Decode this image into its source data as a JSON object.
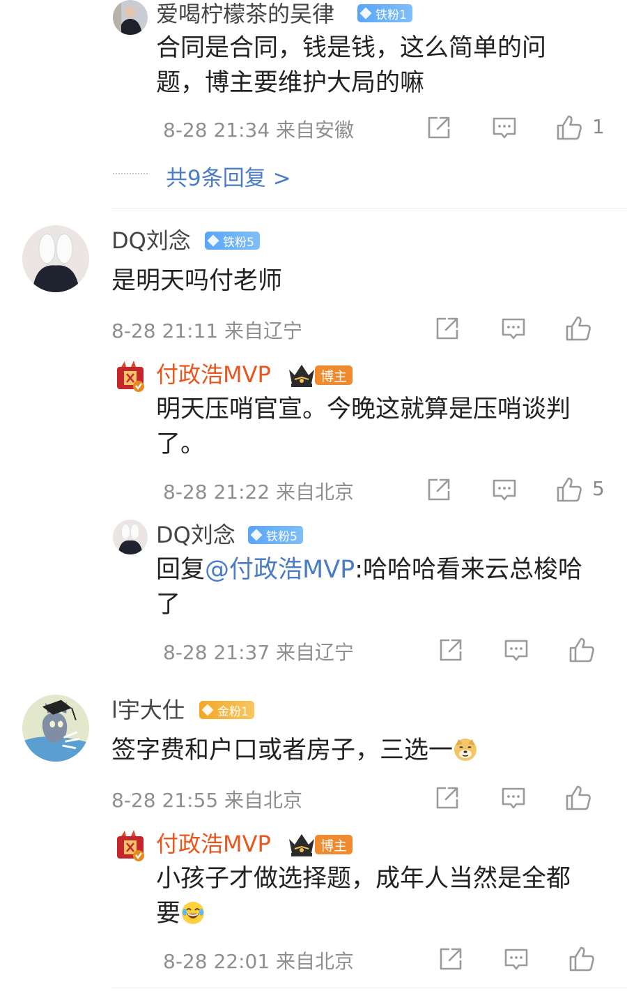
{
  "reply1": {
    "username": "爱喝柠檬茶的吴律",
    "badge": "铁粉1",
    "text": "合同是合同，钱是钱，这么简单的问题，博主要维护大局的嘛",
    "meta": "8-28 21:34 来自安徽",
    "likes": "1",
    "more_replies": "共9条回复 >"
  },
  "comment1": {
    "username": "DQ刘念",
    "badge": "铁粉5",
    "text": "是明天吗付老师",
    "meta": "8-28 21:11 来自辽宁",
    "replies": [
      {
        "username": "付政浩MVP",
        "role_badge": "博主",
        "text": "明天压哨官宣。今晚这就算是压哨谈判了。",
        "meta": "8-28 21:22 来自北京",
        "likes": "5"
      },
      {
        "username": "DQ刘念",
        "badge": "铁粉5",
        "reply_prefix": "回复",
        "mention": "@付政浩MVP",
        "text": ":哈哈哈看来云总梭哈了",
        "meta": "8-28 21:37 来自辽宁"
      }
    ]
  },
  "comment2": {
    "username": "l宇大仕",
    "badge": "金粉1",
    "text": "签字费和户口或者房子，三选一",
    "meta": "8-28 21:55 来自北京",
    "replies": [
      {
        "username": "付政浩MVP",
        "role_badge": "博主",
        "text": "小孩子才做选择题，成年人当然是全都要",
        "meta": "8-28 22:01 来自北京"
      }
    ]
  },
  "colors": {
    "blogger_name": "#e8561d",
    "mention": "#4a7cc7",
    "badge_blue": "#5aa5f7",
    "badge_gold": "#f5a623"
  },
  "icons": [
    "share-icon",
    "comment-icon",
    "like-icon",
    "crown-icon",
    "dots-icon",
    "doge-emoji",
    "laughing-emoji"
  ]
}
